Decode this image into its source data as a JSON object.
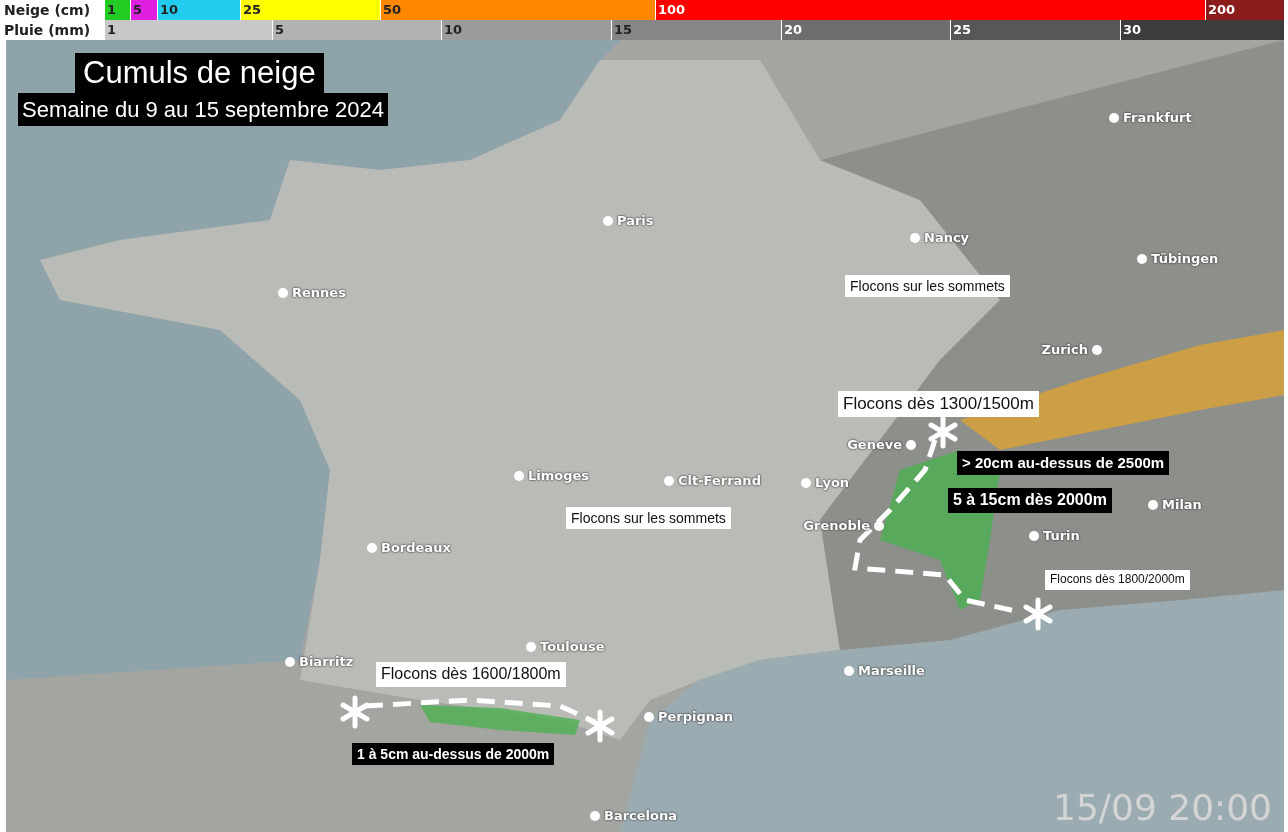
{
  "legend": {
    "snow": {
      "label": "Neige (cm)",
      "steps": [
        {
          "value": "1",
          "color": "#22cc22"
        },
        {
          "value": "5",
          "color": "#e020e0"
        },
        {
          "value": "10",
          "color": "#22ccee"
        },
        {
          "value": "25",
          "color": "#ffff00"
        },
        {
          "value": "50",
          "color": "#ff8800"
        },
        {
          "value": "100",
          "color": "#ff0000"
        },
        {
          "value": "200",
          "color": "#8a1c1c"
        }
      ]
    },
    "rain": {
      "label": "Pluie (mm)",
      "steps": [
        {
          "value": "1",
          "color": "#c8c8c8"
        },
        {
          "value": "5",
          "color": "#b2b2b2"
        },
        {
          "value": "10",
          "color": "#9c9c9c"
        },
        {
          "value": "15",
          "color": "#868686"
        },
        {
          "value": "20",
          "color": "#6e6e6e"
        },
        {
          "value": "25",
          "color": "#575757"
        },
        {
          "value": "30",
          "color": "#3c3c3c"
        }
      ]
    }
  },
  "title": "Cumuls de neige",
  "subtitle": "Semaine du 9 au 15 septembre 2024",
  "cities": [
    {
      "name": "Frankfurt"
    },
    {
      "name": "Paris"
    },
    {
      "name": "Nancy"
    },
    {
      "name": "Tübingen"
    },
    {
      "name": "Rennes"
    },
    {
      "name": "Zurich"
    },
    {
      "name": "Geneve"
    },
    {
      "name": "Limoges"
    },
    {
      "name": "Clt-Ferrand"
    },
    {
      "name": "Lyon"
    },
    {
      "name": "Milan"
    },
    {
      "name": "Grenoble"
    },
    {
      "name": "Turin"
    },
    {
      "name": "Bordeaux"
    },
    {
      "name": "Toulouse"
    },
    {
      "name": "Biarritz"
    },
    {
      "name": "Marseille"
    },
    {
      "name": "Perpignan"
    },
    {
      "name": "Barcelona"
    }
  ],
  "annotations": [
    {
      "text": "Flocons sur les sommets",
      "kind": "light"
    },
    {
      "text": "Flocons dès 1300/1500m",
      "kind": "light"
    },
    {
      "text": "> 20cm au-dessus de 2500m",
      "kind": "dark"
    },
    {
      "text": "5 à 15cm dès 2000m",
      "kind": "dark"
    },
    {
      "text": "Flocons sur les sommets",
      "kind": "light"
    },
    {
      "text": "Flocons dès 1800/2000m",
      "kind": "light"
    },
    {
      "text": "Flocons dès 1600/1800m",
      "kind": "light"
    },
    {
      "text": "1 à 5cm au-dessus de 2000m",
      "kind": "dark"
    }
  ],
  "timestamp": "15/09 20:00"
}
